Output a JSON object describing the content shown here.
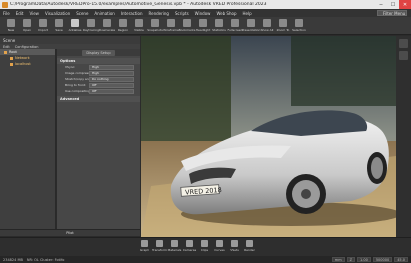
{
  "window": {
    "title": "C:/ProgramData/Autodesk/VREDPro-15.0/examples/Automotive_Genesis.vpb * - Autodesk VRED Professional 2023",
    "minimize": "─",
    "maximize": "☐",
    "close": "✕"
  },
  "menu": {
    "items": [
      "File",
      "Edit",
      "View",
      "Visualization",
      "Scene",
      "Animation",
      "Interaction",
      "Rendering",
      "Scripts",
      "Window",
      "Web Shop",
      "Help"
    ],
    "search_placeholder": "Filter Menu"
  },
  "toolbar": {
    "items": [
      "New",
      "Open",
      "Import",
      "Save",
      "Antialias",
      "Raytracing",
      "Downscale",
      "Region",
      "Visible",
      "Snapshots",
      "Wireframe",
      "Bookmarks",
      "Headlight",
      "Statistics",
      "Fullscreen",
      "Presentation",
      "Show All",
      "Zoom To",
      "Selection"
    ]
  },
  "scenegraph": {
    "title": "Scene",
    "header_tabs": [
      "Edit",
      "Configuration"
    ],
    "tree": [
      {
        "label": "Root",
        "level": 0,
        "selected": true
      },
      {
        "label": "Network",
        "level": 1,
        "selected": false
      },
      {
        "label": "localhost",
        "level": 1,
        "selected": false
      }
    ]
  },
  "properties": {
    "tab": "Display Setup",
    "section_options": "Options",
    "rows": [
      {
        "label": "VSync:",
        "value": "High"
      },
      {
        "label": "Image compression:",
        "value": "High"
      },
      {
        "label": "Stretch/copy scale:",
        "value": "Do nothing"
      },
      {
        "label": "Bring to front:",
        "value": "Off"
      },
      {
        "label": "Use compositing:",
        "value": "Off"
      }
    ],
    "section_advanced": "Advanced"
  },
  "left_bottom_tab": "Pilot",
  "viewport": {
    "plate_text": "VRED 2018"
  },
  "bottom_toolbar": {
    "items": [
      "Graph",
      "Transform",
      "Materials",
      "Cameras",
      "Clips",
      "Curves",
      "VSets",
      "Render"
    ]
  },
  "status": {
    "memory": "234824 MB",
    "info": "NR: OL  Cluster: Fotifo",
    "units": "mm",
    "up": "Z",
    "ncp": "1.00",
    "fcp": "500000",
    "fov": "45.0"
  }
}
